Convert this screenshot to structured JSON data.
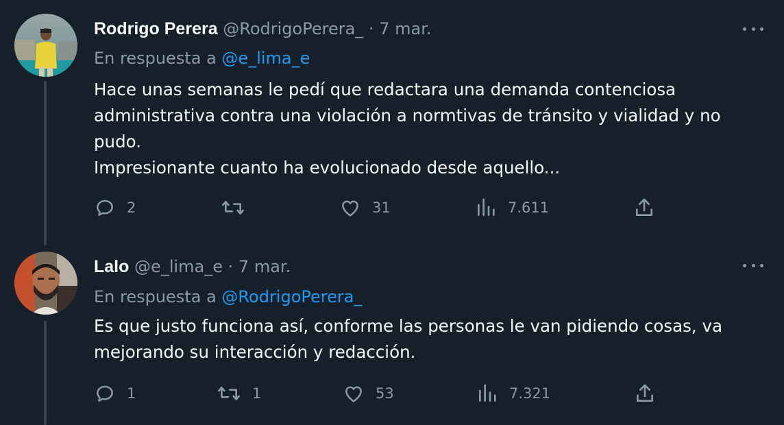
{
  "tweets": [
    {
      "name": "Rodrigo Perera",
      "handle": "@RodrigoPerera_",
      "separator": "·",
      "date": "7 mar.",
      "reply_prefix": "En respuesta a",
      "reply_to": "@e_lima_e",
      "lines": [
        "Hace unas semanas le pedí que redactara una demanda contenciosa",
        "administrativa contra una violación a normtivas de tránsito y vialidad y no",
        "pudo.",
        "Impresionante cuanto ha evolucionado desde aquello..."
      ],
      "actions": {
        "replies": "2",
        "retweets": "",
        "likes": "31",
        "views": "7.611"
      },
      "avatar_icon": "user-avatar-photo"
    },
    {
      "name": "Lalo",
      "handle": "@e_lima_e",
      "separator": "·",
      "date": "7 mar.",
      "reply_prefix": "En respuesta a",
      "reply_to": "@RodrigoPerera_",
      "lines": [
        "Es que justo funciona así, conforme las personas le van pidiendo cosas, va",
        "mejorando su interacción y redacción."
      ],
      "actions": {
        "replies": "1",
        "retweets": "1",
        "likes": "53",
        "views": "7.321"
      },
      "avatar_icon": "user-avatar-photo"
    }
  ],
  "icons": {
    "reply": "reply-icon",
    "retweet": "retweet-icon",
    "like": "like-icon",
    "views": "views-icon",
    "share": "share-icon",
    "more": "more-icon"
  },
  "colors": {
    "background": "#15202b",
    "text": "#f7f9f9",
    "secondary": "#8b98a5",
    "link": "#1d9bf0",
    "thread_line": "#38444d"
  }
}
